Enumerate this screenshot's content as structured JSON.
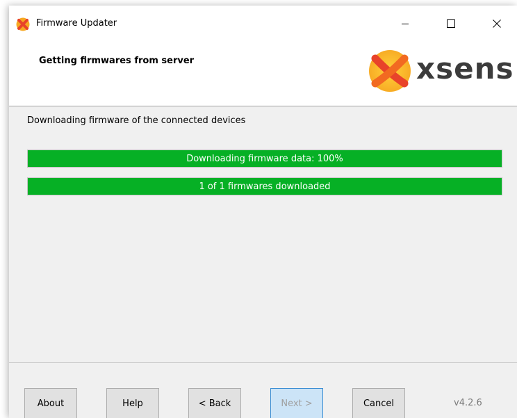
{
  "window": {
    "title": "Firmware Updater",
    "icon": "xsens-logo-icon",
    "controls": [
      "minimize-icon",
      "maximize-icon",
      "close-icon"
    ]
  },
  "header": {
    "title": "Getting firmwares from server",
    "brand": "xsens"
  },
  "main": {
    "description": "Downloading firmware of the connected devices",
    "progress": [
      {
        "label": "Downloading firmware data: 100%",
        "value": 1.0
      },
      {
        "label": "1 of 1 firmwares downloaded",
        "value": 1.0
      }
    ]
  },
  "footer": {
    "about": "About",
    "help": "Help",
    "back": "< Back",
    "next": "Next >",
    "cancel": "Cancel",
    "version": "v4.2.6"
  },
  "colors": {
    "progress": "#06b025",
    "brand_orange": "#f26a21",
    "brand_yellow": "#f7a823"
  }
}
